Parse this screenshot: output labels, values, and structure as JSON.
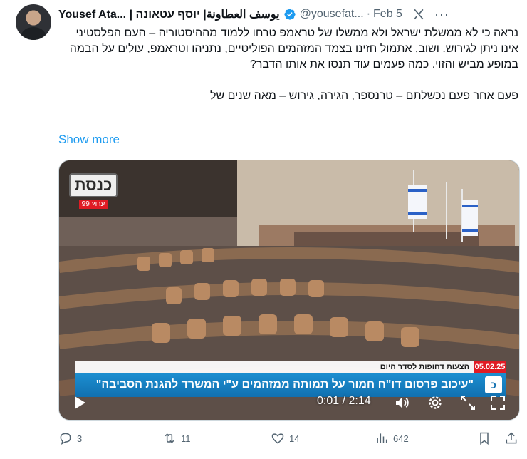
{
  "author": {
    "name": "Yousef Ata... | يوسف العطاونة| יוסף עטאונה",
    "handle": "@yousefat...",
    "date": "Feb 5"
  },
  "tweet": {
    "paragraph1": "נראה כי לא ממשלת ישראל ולא ממשלו של טראמפ טרחו ללמוד מההיסטוריה – העם הפלסטיני אינו ניתן לגירוש. ושוב, אתמול חזינו בצמד המזהמים הפוליטיים, נתניהו וטראמפ, עולים על הבמה במופע מביש והזוי. כמה פעמים עוד תנסו את אותו הדבר?",
    "paragraph2": "פעם אחר פעם נכשלתם – טרנספר, הגירה, גירוש – מאה שנים של",
    "show_more": "Show more"
  },
  "video": {
    "channel_logo": "כנסת",
    "channel_sub": "ערוץ 99",
    "date_tag": "05.02.25",
    "topic": "הצעות דחופות לסדר היום",
    "headline": "\"עיכוב פרסום דו\"ח חמור על תמותה ממזהמים ע\"י המשרד להגנת הסביבה\"",
    "badge": "כ",
    "time": "0:01 / 2:14",
    "progress": 0.007
  },
  "stats": {
    "replies": "3",
    "reposts": "11",
    "likes": "14",
    "views": "642"
  },
  "colors": {
    "accent": "#1d9bf0",
    "muted": "#536471",
    "headline_bar": "#1170b0",
    "date_red": "#e01b24"
  },
  "icons": [
    "verified-badge-icon",
    "grok-icon",
    "more-options-icon",
    "play-icon",
    "volume-icon",
    "settings-icon",
    "minimize-icon",
    "fullscreen-icon",
    "reply-icon",
    "repost-icon",
    "like-icon",
    "views-icon",
    "bookmark-icon",
    "share-icon"
  ]
}
